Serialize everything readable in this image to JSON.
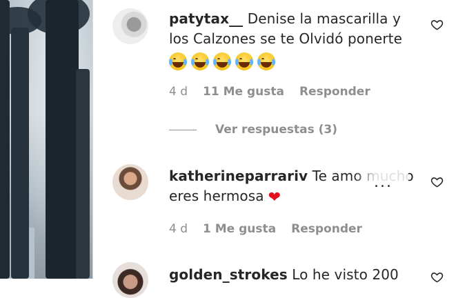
{
  "comments": [
    {
      "username": "patytax__",
      "text": "Denise la mascarilla y los Calzones se te Olvidó ponerte",
      "emojis": [
        "face-with-tears-of-joy",
        "face-with-tears-of-joy",
        "face-with-tears-of-joy",
        "face-with-tears-of-joy",
        "face-with-tears-of-joy"
      ],
      "time": "4 d",
      "likes": "11 Me gusta",
      "reply_label": "Responder"
    },
    {
      "username": "katherineparrariv",
      "text": "Te amo mucho eres hermosa",
      "emoji": "red-heart",
      "time": "4 d",
      "likes": "1 Me gusta",
      "reply_label": "Responder"
    },
    {
      "username": "golden_strokes",
      "text": "Lo he visto 200"
    }
  ],
  "view_replies": "Ver respuestas (3)",
  "more_options": "...",
  "colors": {
    "text": "#262626",
    "secondary": "#8e8e8e",
    "heart": "#e0131d",
    "divider": "#dbdbdb"
  },
  "icons": [
    "heart-outline-icon",
    "more-options-icon"
  ]
}
